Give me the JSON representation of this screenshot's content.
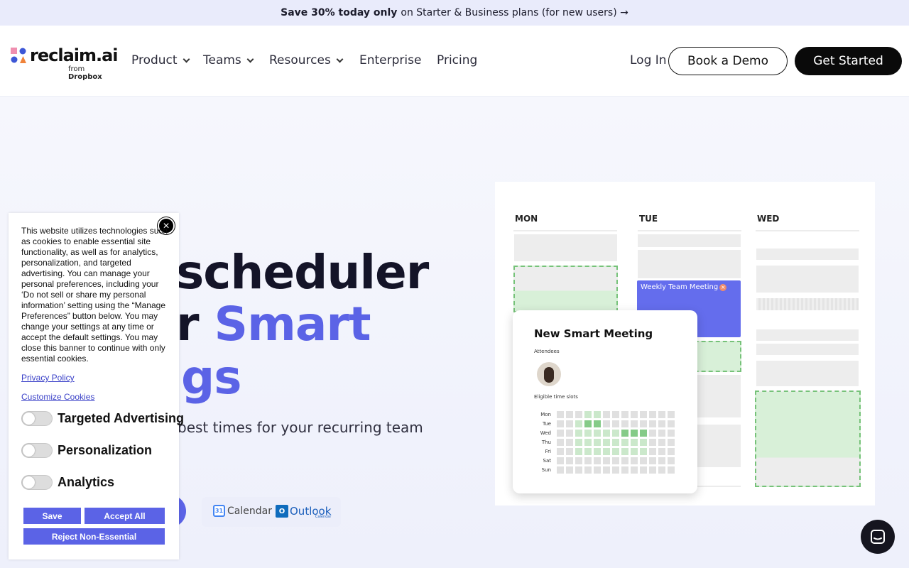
{
  "promo": {
    "bold": "Save 30% today only",
    "rest": "on Starter & Business plans (for new users) →"
  },
  "logo": {
    "name": "reclaim.ai",
    "from": "from",
    "brand": "Dropbox"
  },
  "nav": {
    "items": [
      {
        "label": "Product",
        "dropdown": true
      },
      {
        "label": "Teams",
        "dropdown": true
      },
      {
        "label": "Resources",
        "dropdown": true
      },
      {
        "label": "Enterprise",
        "dropdown": false
      },
      {
        "label": "Pricing",
        "dropdown": false
      }
    ],
    "login": "Log In",
    "demo": "Book a Demo",
    "start": "Get Started"
  },
  "hero": {
    "line1": "scheduler",
    "line2_prefix": "r",
    "line2_accent": "Smart",
    "line3": "gs",
    "subtitle": "best times for your recurring team",
    "accent_color": "#5b63e6"
  },
  "integrations": {
    "gcal_icon": "31",
    "gcal": "Calendar",
    "outlook_icon": "O",
    "outlook": "Outlook",
    "outlook_sub": "Calendar"
  },
  "calendar": {
    "days": [
      "MON",
      "TUE",
      "WED"
    ],
    "event": "Weekly Team Meeting",
    "card_title": "New Smart Meeting",
    "attendees_label": "Attendees",
    "slots_label": "Eligible time slots",
    "slot_days": [
      {
        "day": "Mon",
        "cells": "0001100000000"
      },
      {
        "day": "Tue",
        "cells": "0012200000000"
      },
      {
        "day": "Wed",
        "cells": "0011111222000"
      },
      {
        "day": "Thu",
        "cells": "0011111111000"
      },
      {
        "day": "Fri",
        "cells": "0011111111000"
      },
      {
        "day": "Sat",
        "cells": "0000000000000"
      },
      {
        "day": "Sun",
        "cells": "0000000000000"
      }
    ]
  },
  "cookie": {
    "text": "This website utilizes technologies such as cookies to enable essential site functionality, as well as for analytics, personalization, and targeted advertising. You can manage your personal preferences, including your ‘Do not sell or share my personal information’ setting using the “Manage Preferences” button below. You may change your settings at any time or accept the default settings. You may close this banner to continue with only essential cookies.",
    "privacy": "Privacy Policy",
    "customize": "Customize Cookies",
    "toggles": [
      "Targeted Advertising",
      "Personalization",
      "Analytics"
    ],
    "save": "Save",
    "accept": "Accept All",
    "reject": "Reject Non-Essential",
    "close": "×"
  }
}
